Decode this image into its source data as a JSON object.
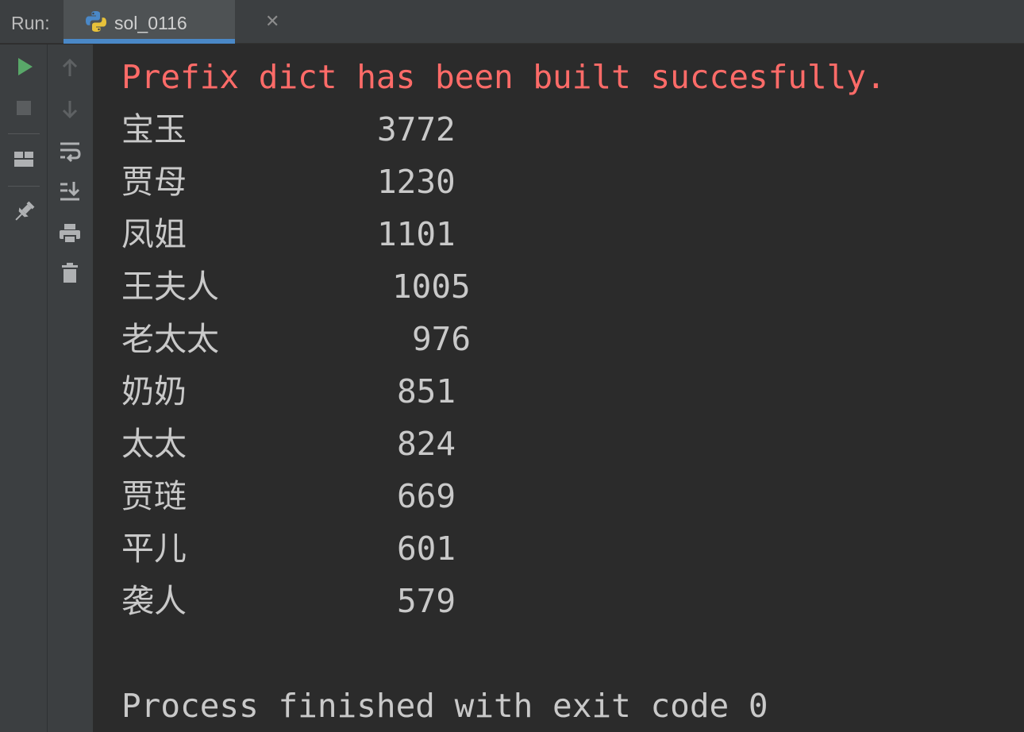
{
  "header": {
    "run_label": "Run:",
    "tab": {
      "label": "sol_0116",
      "icon": "python-icon",
      "close_glyph": "✕"
    }
  },
  "toolbar_left": {
    "items": [
      "rerun-icon",
      "stop-icon",
      "layout-icon",
      "pin-icon"
    ]
  },
  "toolbar_right": {
    "items": [
      "up-arrow-icon",
      "down-arrow-icon",
      "soft-wrap-icon",
      "scroll-to-end-icon",
      "print-icon",
      "trash-icon"
    ]
  },
  "console": {
    "prefix_message": "Prefix dict has been built succesfully.",
    "rows": [
      {
        "name": "宝玉",
        "count": "3772"
      },
      {
        "name": "贾母",
        "count": "1230"
      },
      {
        "name": "凤姐",
        "count": "1101"
      },
      {
        "name": "王夫人",
        "count": "1005"
      },
      {
        "name": "老太太",
        "count": "976"
      },
      {
        "name": "奶奶",
        "count": "851"
      },
      {
        "name": "太太",
        "count": "824"
      },
      {
        "name": "贾琏",
        "count": "669"
      },
      {
        "name": "平儿",
        "count": "601"
      },
      {
        "name": "袭人",
        "count": "579"
      }
    ],
    "exit_message": "Process finished with exit code 0"
  },
  "colors": {
    "accent": "#4a88c7",
    "error_text": "#ff6b68",
    "run_green": "#59a869",
    "text": "#c9c9c9",
    "background": "#2b2b2b",
    "panel": "#3c3f41"
  }
}
